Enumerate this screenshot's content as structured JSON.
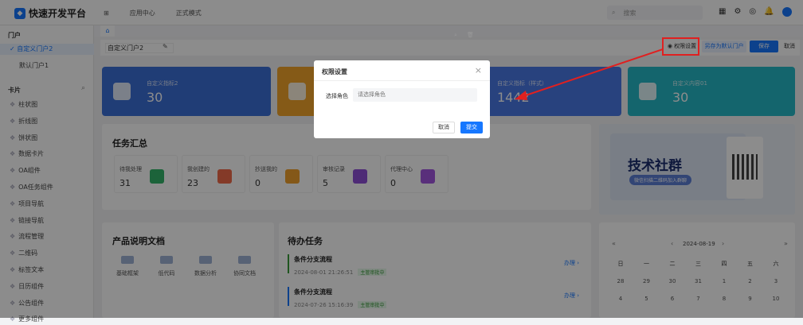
{
  "app": {
    "title": "快速开发平台",
    "logo_icon": "logo-mark"
  },
  "topnav": {
    "grid_icon": "apps-icon",
    "items": [
      "应用中心",
      "正式模式"
    ]
  },
  "search": {
    "placeholder": "搜索"
  },
  "sidebar": {
    "portal_header": "门户",
    "portals": [
      {
        "label": "自定义门户2",
        "active": true
      },
      {
        "label": "默认门户1",
        "active": false
      }
    ],
    "card_header": "卡片",
    "cards": [
      "柱状图",
      "折线图",
      "饼状图",
      "数据卡片",
      "OA组件",
      "OA任务组件",
      "项目导航",
      "链接导航",
      "流程管理",
      "二维码",
      "标签文本",
      "日历组件",
      "公告组件",
      "更多组件"
    ]
  },
  "toolbar": {
    "portal_name": "自定义门户2",
    "perm_label": "权限设置",
    "save_default_label": "另存为默认门户",
    "save_label": "保存",
    "cancel_label": "取消"
  },
  "stat_cards": [
    {
      "title": "自定义指标2",
      "value": "30",
      "color": "#3b6fd8"
    },
    {
      "title": "",
      "value": "",
      "color": "#f3a52b"
    },
    {
      "title": "自定义指标（样式）",
      "value": "1442",
      "color": "#4a78e6"
    },
    {
      "title": "自定义内容01",
      "value": "30",
      "color": "#25b8c7"
    }
  ],
  "tasks": {
    "title": "任务汇总",
    "items": [
      {
        "label": "待我处理",
        "count": "31",
        "color": "#34b46a"
      },
      {
        "label": "我创建的",
        "count": "23",
        "color": "#f06b4a"
      },
      {
        "label": "抄送我的",
        "count": "0",
        "color": "#f0a12d"
      },
      {
        "label": "审核记录",
        "count": "5",
        "color": "#8e4fd8"
      },
      {
        "label": "代理中心",
        "count": "0",
        "color": "#a356e0"
      }
    ]
  },
  "banner": {
    "title": "技术社群",
    "subtitle": "微信扫描二维码加入群聊"
  },
  "docs": {
    "title": "产品说明文档",
    "items": [
      "基础框架",
      "低代码",
      "数据分析",
      "协同文档"
    ]
  },
  "todos": {
    "title": "待办任务",
    "items": [
      {
        "name": "条件分支流程",
        "date": "2024-08-01 21:26:51",
        "tag": "主管审批中",
        "action": "办理"
      },
      {
        "name": "条件分支流程",
        "date": "2024-07-26 15:16:39",
        "tag": "主管审批中",
        "action": "办理"
      }
    ]
  },
  "calendar": {
    "nav_prev2": "«",
    "nav_prev": "‹",
    "nav_next": "›",
    "nav_next2": "»",
    "month": "2024-08-19",
    "weekdays": [
      "日",
      "一",
      "二",
      "三",
      "四",
      "五",
      "六"
    ],
    "rows": [
      [
        "28",
        "29",
        "30",
        "31",
        "1",
        "2",
        "3"
      ],
      [
        "4",
        "5",
        "6",
        "7",
        "8",
        "9",
        "10"
      ]
    ]
  },
  "modal": {
    "title": "权限设置",
    "role_label": "选择角色",
    "role_placeholder": "请选择角色",
    "cancel": "取消",
    "submit": "提交"
  }
}
